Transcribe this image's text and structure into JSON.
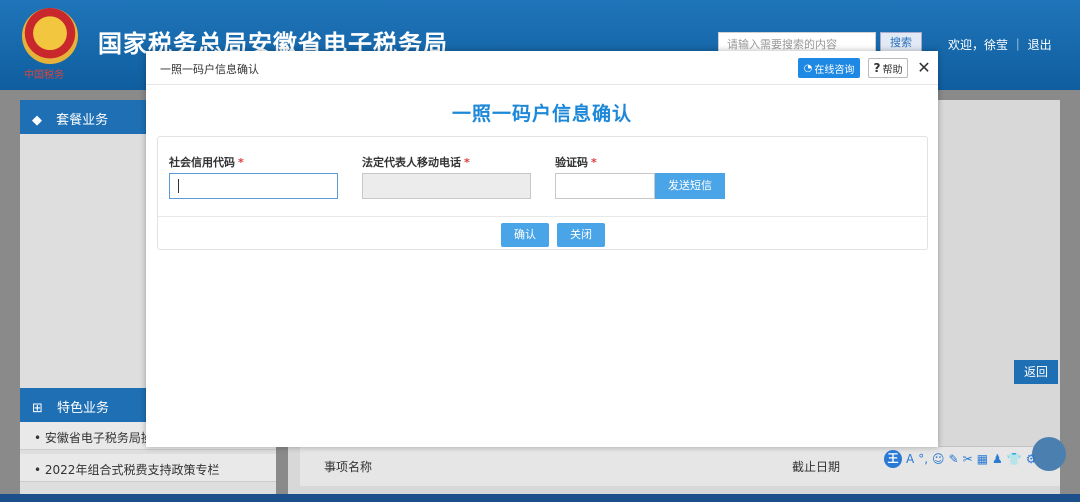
{
  "background": {
    "emblem_caption": "中国税务",
    "site_title": "国家税务总局安徽省电子税务局",
    "search_placeholder": "请输入需要搜索的内容",
    "search_button": "搜索",
    "welcome": "欢迎，徐莹 ｜ 退出",
    "left_panel_1_title": "套餐业务",
    "left_panel_2_title": "特色业务",
    "left_items": [
      "安徽省电子税务局操",
      "2022年组合式税费支持政策专栏"
    ],
    "return_button": "返回",
    "table_col_1": "事项名称",
    "table_col_2": "截止日期"
  },
  "modal": {
    "window_title": "一照一码户信息确认",
    "online_consult": "在线咨询",
    "help": "帮助",
    "close": "✕",
    "heading": "一照一码户信息确认",
    "fields": [
      {
        "label": "社会信用代码",
        "required_mark": "*",
        "value": ""
      },
      {
        "label": "法定代表人移动电话",
        "required_mark": "*",
        "value": ""
      },
      {
        "label": "验证码",
        "required_mark": "*",
        "value": ""
      }
    ],
    "send_sms": "发送短信",
    "confirm": "确认",
    "cancel": "关闭"
  },
  "ime_toolbar": {
    "logo": "王",
    "items": [
      "A",
      "°,",
      "☺",
      "✎",
      "✂",
      "▦",
      "♟",
      "👕",
      "⚙"
    ]
  },
  "colors": {
    "accent": "#1e88d8",
    "button": "#4aa5e8",
    "required": "#e03c3c",
    "header_bg": "#1f75b9"
  }
}
